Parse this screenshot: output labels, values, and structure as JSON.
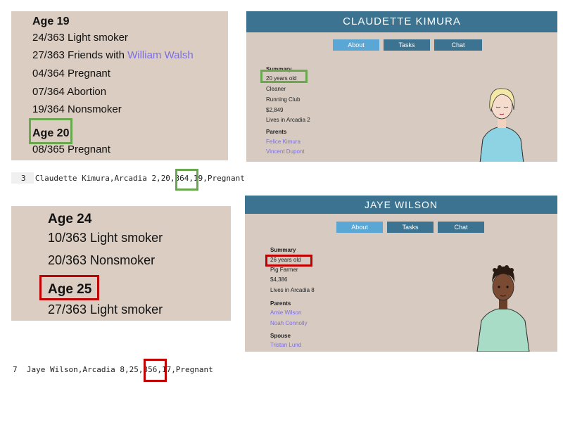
{
  "panel1": {
    "lines": [
      {
        "text": "Age 19"
      },
      {
        "text": "24/363  Light smoker"
      },
      {
        "pre": "27/363  Friends with ",
        "link": "William Walsh"
      },
      {
        "text": "04/364  Pregnant"
      },
      {
        "text": "07/364  Abortion"
      },
      {
        "text": "19/364  Nonsmoker"
      },
      {
        "text": "Age 20"
      },
      {
        "text": "08/365  Pregnant"
      }
    ]
  },
  "profile1": {
    "name": "CLAUDETTE KIMURA",
    "tabs": [
      "About",
      "Tasks",
      "Chat"
    ],
    "summary_heading": "Summary",
    "age": "20 years old",
    "job": "Cleaner",
    "club": "Running Club",
    "money": "$2,849",
    "home": "Lives in Arcadia 2",
    "parents_heading": "Parents",
    "parents": [
      "Felice Kimura",
      "Vincent Dupont"
    ]
  },
  "csv1": {
    "num": "3",
    "pre": "Claudette Kimura,Arcadia 2,",
    "hl": "20,",
    "post": "364,19,Pregnant"
  },
  "panel2": {
    "lines": [
      {
        "text": "Age 24"
      },
      {
        "text": "10/363  Light smoker"
      },
      {
        "text": "20/363  Nonsmoker"
      },
      {
        "text": "Age 25"
      },
      {
        "text": "27/363  Light smoker"
      }
    ]
  },
  "profile2": {
    "name": "JAYE WILSON",
    "tabs": [
      "About",
      "Tasks",
      "Chat"
    ],
    "summary_heading": "Summary",
    "age": "26 years old",
    "job": "Pig Farmer",
    "money": "$4,386",
    "home": "Lives in Arcadia 8",
    "parents_heading": "Parents",
    "parents": [
      "Amie Wilson",
      "Noah Connolly"
    ],
    "spouse_heading": "Spouse",
    "spouse": "Tristan Lund"
  },
  "csv2": {
    "num": "7",
    "pre": "Jaye Wilson,Arcadia 8,",
    "hl": "25,",
    "post": "356,17,Pregnant"
  },
  "colors": {
    "panel": "#dbcdc1",
    "header": "#3b7390",
    "active_tab": "#5aa7d6",
    "link": "#7b6ee0",
    "green_box": "#6aa84f",
    "red_box": "#c00000"
  }
}
